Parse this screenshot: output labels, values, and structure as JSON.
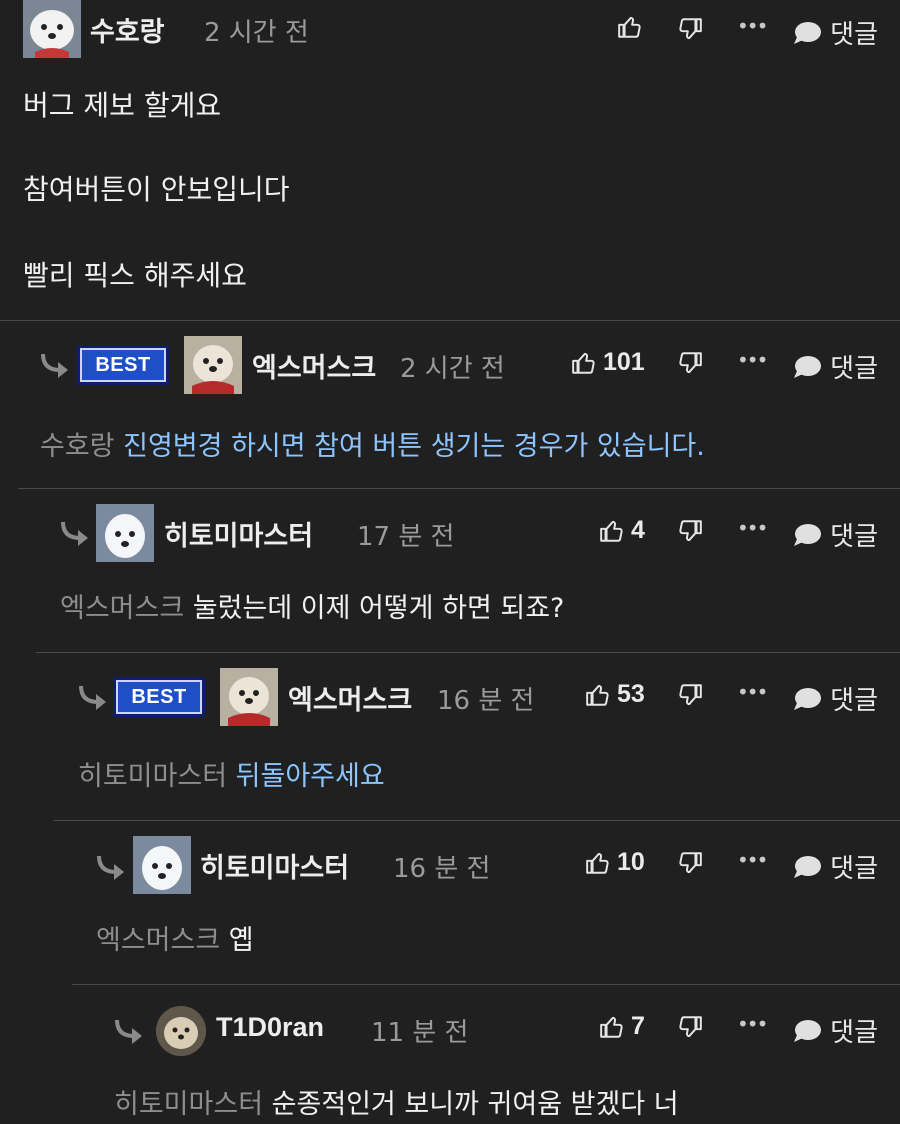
{
  "colors": {
    "background": "#202020",
    "best_badge": "#1f4fc8",
    "blue_text": "#8cc4ff",
    "mention": "#8e8e8e"
  },
  "post": {
    "username": "수호랑",
    "time": "2 시간 전",
    "lines": [
      "버그 제보 할게요",
      "참여버튼이 안보입니다",
      "빨리 픽스 해주세요"
    ],
    "reply_label": "댓글"
  },
  "comments": [
    {
      "best": "BEST",
      "username": "엑스머스크",
      "time": "2 시간 전",
      "likes": "101",
      "mention": "수호랑",
      "text": "진영변경 하시면 참여 버튼 생기는 경우가 있습니다.",
      "reply_label": "댓글"
    },
    {
      "username": "히토미마스터",
      "time": "17 분 전",
      "likes": "4",
      "mention": "엑스머스크",
      "text": "눌렀는데 이제 어떻게 하면 되죠?",
      "reply_label": "댓글"
    },
    {
      "best": "BEST",
      "username": "엑스머스크",
      "time": "16 분 전",
      "likes": "53",
      "mention": "히토미마스터",
      "text": "뒤돌아주세요",
      "reply_label": "댓글"
    },
    {
      "username": "히토미마스터",
      "time": "16 분 전",
      "likes": "10",
      "mention": "엑스머스크",
      "text": "옙",
      "reply_label": "댓글"
    },
    {
      "username": "T1D0ran",
      "time": "11 분 전",
      "likes": "7",
      "mention": "히토미마스터",
      "text": "순종적인거 보니까 귀여움 받겠다 너",
      "reply_label": "댓글"
    }
  ]
}
